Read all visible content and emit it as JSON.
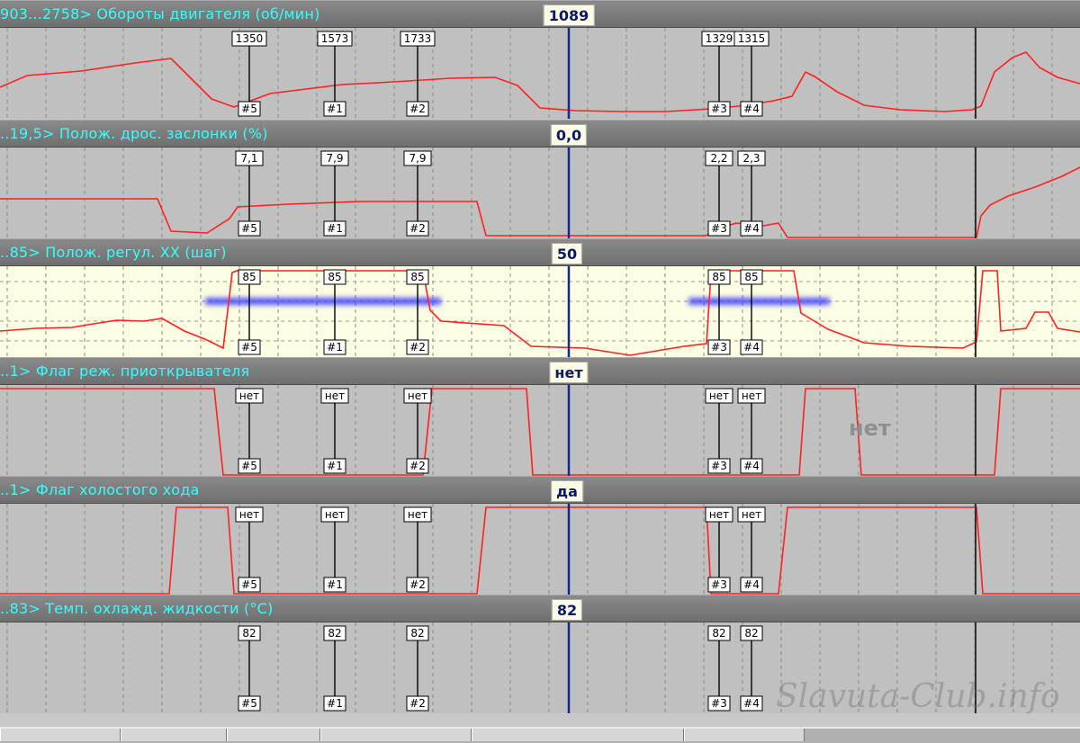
{
  "cursor_label": "1089",
  "markers": [
    {
      "id": "#5"
    },
    {
      "id": "#1"
    },
    {
      "id": "#2"
    },
    {
      "id": "#3"
    },
    {
      "id": "#4"
    }
  ],
  "panels": [
    {
      "key": "rpm",
      "label": "903...2758>  Обороты двигателя (об/мин)",
      "value": "1089",
      "background": "#c0c0c0",
      "marker_values": [
        "1350",
        "1573",
        "1733",
        "1329",
        "1315"
      ],
      "series": [
        [
          0,
          97
        ],
        [
          30,
          84
        ],
        [
          90,
          79
        ],
        [
          150,
          70
        ],
        [
          190,
          65
        ],
        [
          205,
          80
        ],
        [
          235,
          110
        ],
        [
          260,
          119
        ],
        [
          300,
          104
        ],
        [
          340,
          99
        ],
        [
          380,
          94
        ],
        [
          420,
          92
        ],
        [
          470,
          89
        ],
        [
          500,
          87
        ],
        [
          550,
          86
        ],
        [
          575,
          95
        ],
        [
          600,
          120
        ],
        [
          640,
          123
        ],
        [
          690,
          124
        ],
        [
          740,
          124
        ],
        [
          790,
          121
        ],
        [
          820,
          118
        ],
        [
          860,
          112
        ],
        [
          880,
          107
        ],
        [
          895,
          80
        ],
        [
          905,
          85
        ],
        [
          930,
          102
        ],
        [
          960,
          117
        ],
        [
          1000,
          122
        ],
        [
          1050,
          124
        ],
        [
          1080,
          122
        ],
        [
          1090,
          118
        ],
        [
          1105,
          80
        ],
        [
          1125,
          64
        ],
        [
          1140,
          58
        ],
        [
          1155,
          75
        ],
        [
          1175,
          86
        ],
        [
          1200,
          93
        ]
      ]
    },
    {
      "key": "throttle",
      "label": "..19,5>  Полож. дрос. заслонки (%)",
      "value": "0,0",
      "background": "#c0c0c0",
      "marker_values": [
        "7,1",
        "7,9",
        "7,9",
        "2,2",
        "2,3"
      ],
      "series": [
        [
          0,
          221
        ],
        [
          175,
          221
        ],
        [
          190,
          257
        ],
        [
          230,
          259
        ],
        [
          255,
          243
        ],
        [
          264,
          230
        ],
        [
          320,
          227
        ],
        [
          400,
          224
        ],
        [
          480,
          224
        ],
        [
          530,
          224
        ],
        [
          540,
          262
        ],
        [
          785,
          262
        ],
        [
          792,
          256
        ],
        [
          818,
          248
        ],
        [
          848,
          251
        ],
        [
          865,
          248
        ],
        [
          875,
          264
        ],
        [
          1085,
          264
        ],
        [
          1090,
          240
        ],
        [
          1100,
          228
        ],
        [
          1120,
          218
        ],
        [
          1150,
          208
        ],
        [
          1180,
          196
        ],
        [
          1200,
          186
        ]
      ]
    },
    {
      "key": "idle_valve",
      "label": "..85>  Полож. регул. XX (шаг)",
      "value": "50",
      "background": "#fdfde4",
      "marker_values": [
        "85",
        "85",
        "85",
        "85",
        "85"
      ],
      "highlight_bands": [
        [
          228,
          490
        ],
        [
          765,
          922
        ]
      ],
      "series": [
        [
          0,
          368
        ],
        [
          40,
          365
        ],
        [
          80,
          364
        ],
        [
          110,
          359
        ],
        [
          130,
          356
        ],
        [
          160,
          357
        ],
        [
          180,
          354
        ],
        [
          205,
          368
        ],
        [
          230,
          378
        ],
        [
          248,
          387
        ],
        [
          258,
          303
        ],
        [
          263,
          301
        ],
        [
          470,
          301
        ],
        [
          478,
          345
        ],
        [
          490,
          357
        ],
        [
          560,
          362
        ],
        [
          590,
          385
        ],
        [
          650,
          387
        ],
        [
          700,
          395
        ],
        [
          760,
          385
        ],
        [
          785,
          382
        ],
        [
          790,
          303
        ],
        [
          800,
          301
        ],
        [
          882,
          301
        ],
        [
          890,
          348
        ],
        [
          920,
          366
        ],
        [
          960,
          381
        ],
        [
          1010,
          385
        ],
        [
          1070,
          387
        ],
        [
          1085,
          380
        ],
        [
          1092,
          301
        ],
        [
          1108,
          301
        ],
        [
          1112,
          368
        ],
        [
          1140,
          365
        ],
        [
          1150,
          347
        ],
        [
          1165,
          347
        ],
        [
          1175,
          365
        ],
        [
          1200,
          369
        ]
      ]
    },
    {
      "key": "opener_flag",
      "label": "..1>  Флаг реж. приоткрывателя",
      "value": "нет",
      "background": "#c0c0c0",
      "marker_values": [
        "нет",
        "нет",
        "нет",
        "нет",
        "нет"
      ],
      "overlay_text": "нет",
      "series": [
        [
          0,
          432
        ],
        [
          238,
          432
        ],
        [
          248,
          528
        ],
        [
          470,
          528
        ],
        [
          480,
          432
        ],
        [
          585,
          432
        ],
        [
          592,
          528
        ],
        [
          888,
          528
        ],
        [
          895,
          432
        ],
        [
          950,
          432
        ],
        [
          957,
          528
        ],
        [
          1105,
          528
        ],
        [
          1112,
          432
        ],
        [
          1200,
          432
        ]
      ]
    },
    {
      "key": "idle_flag",
      "label": "..1>  Флаг холостого хода",
      "value": "да",
      "background": "#c0c0c0",
      "marker_values": [
        "нет",
        "нет",
        "нет",
        "нет",
        "нет"
      ],
      "series": [
        [
          0,
          660
        ],
        [
          188,
          660
        ],
        [
          196,
          564
        ],
        [
          253,
          564
        ],
        [
          260,
          660
        ],
        [
          530,
          660
        ],
        [
          540,
          564
        ],
        [
          785,
          564
        ],
        [
          790,
          660
        ],
        [
          865,
          660
        ],
        [
          875,
          564
        ],
        [
          1085,
          564
        ],
        [
          1092,
          660
        ],
        [
          1200,
          660
        ]
      ]
    },
    {
      "key": "coolant",
      "label": "..83>  Темп. охлажд. жидкости (°С)",
      "value": "82",
      "background": "#c0c0c0",
      "marker_values": [
        "82",
        "82",
        "82",
        "82",
        "82"
      ],
      "series": []
    }
  ],
  "watermark": "Slavuta-Club.info",
  "colors": {
    "trace": "#ff2020",
    "cursor": "#102a8f",
    "header_text": "#33ffff",
    "highlight": "#3a3aff"
  },
  "icons": {
    "marker": "flag-box",
    "cursor": "vertical-line"
  }
}
